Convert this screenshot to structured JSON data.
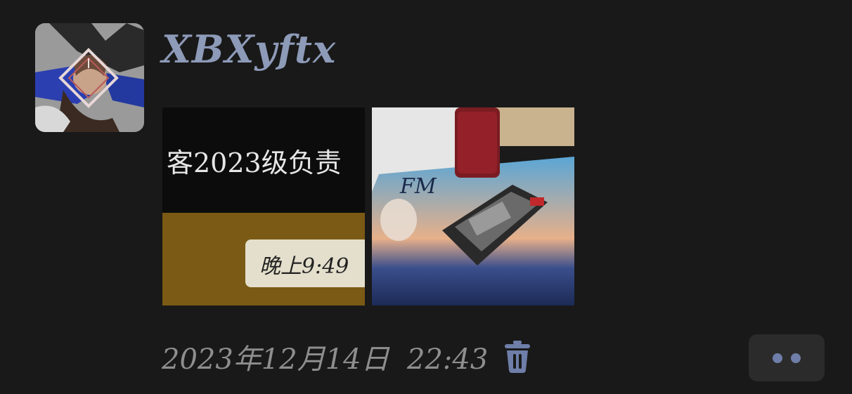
{
  "post": {
    "username": "XBXyftx",
    "timestamp": "2023年12月14日  22:43"
  },
  "photos": [
    {
      "screenshot_text": "客2023级负责",
      "time_badge": "晚上9:49"
    },
    {
      "logo_text": "FM"
    }
  ],
  "icons": {
    "delete": "trash-icon",
    "more": "more-dots-icon"
  },
  "colors": {
    "background": "#191919",
    "username": "#8d9ab8",
    "timestamp": "#8e8e8e",
    "accent": "#6e7ea8",
    "more_button_bg": "#2b2b2b"
  }
}
